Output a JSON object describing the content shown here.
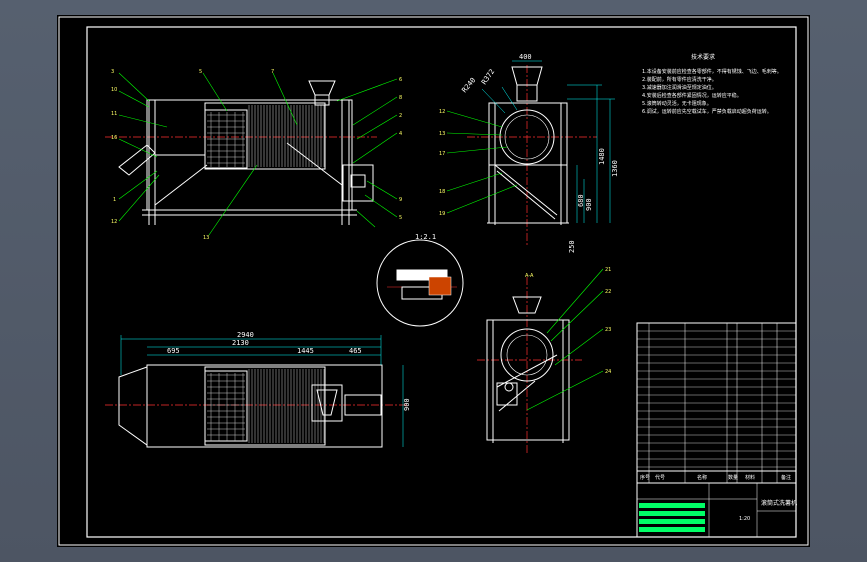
{
  "drawing": {
    "background": "#000000",
    "frame_color": "#ffffff",
    "line_colors": {
      "outline": "#ffffff",
      "leader": "#00ff00",
      "center": "#ff3030",
      "dimension": "#00ffff",
      "hidden": "#ff00ff",
      "label": "#ffff00"
    }
  },
  "front_view": {
    "callouts_left": [
      "3",
      "10",
      "11",
      "16",
      "1",
      "12",
      "13"
    ],
    "callouts_top": [
      "5",
      "7"
    ],
    "callouts_right": [
      "6",
      "8",
      "2",
      "4",
      "9",
      "5"
    ],
    "callout_bottom": "13"
  },
  "side_view": {
    "dim_top": "400",
    "dim_radius_1": "R240",
    "dim_radius_2": "R372",
    "dim_height_1": "1480",
    "dim_height_2": "1360",
    "dim_height_3": "900",
    "dim_height_4": "680",
    "dim_base": "250",
    "callouts_left": [
      "12",
      "13",
      "17",
      "18",
      "19"
    ]
  },
  "detail": {
    "label": "1:2.1"
  },
  "plan_view": {
    "dim_overall": "2940",
    "dim_2": "2130",
    "dim_3": "695",
    "dim_4": "1445",
    "dim_5": "465",
    "dim_depth": "900"
  },
  "section_view": {
    "label_top": "A-A",
    "callouts_right": [
      "21",
      "22",
      "23",
      "24"
    ]
  },
  "notes": {
    "heading": "技术要求",
    "lines": [
      "1.本设备安装前应检查各零部件，不得有锈蚀、飞边、毛刺等。",
      "2.装配前，所有零件应清洗干净。",
      "3.减速器加注润滑油至规定油位。",
      "4.安装后检查各部件紧固情况，运转应平稳。",
      "5.滚筒转动灵活，无卡阻现象。",
      "6.调试，运转前应先空载试车，严禁负载启动超负荷运转。"
    ]
  },
  "title_block": {
    "drawing_title": "滚筒式洗薯机",
    "scale": "1:20",
    "headers": [
      "序号",
      "代号",
      "名称",
      "数量",
      "材料",
      "备注"
    ]
  }
}
